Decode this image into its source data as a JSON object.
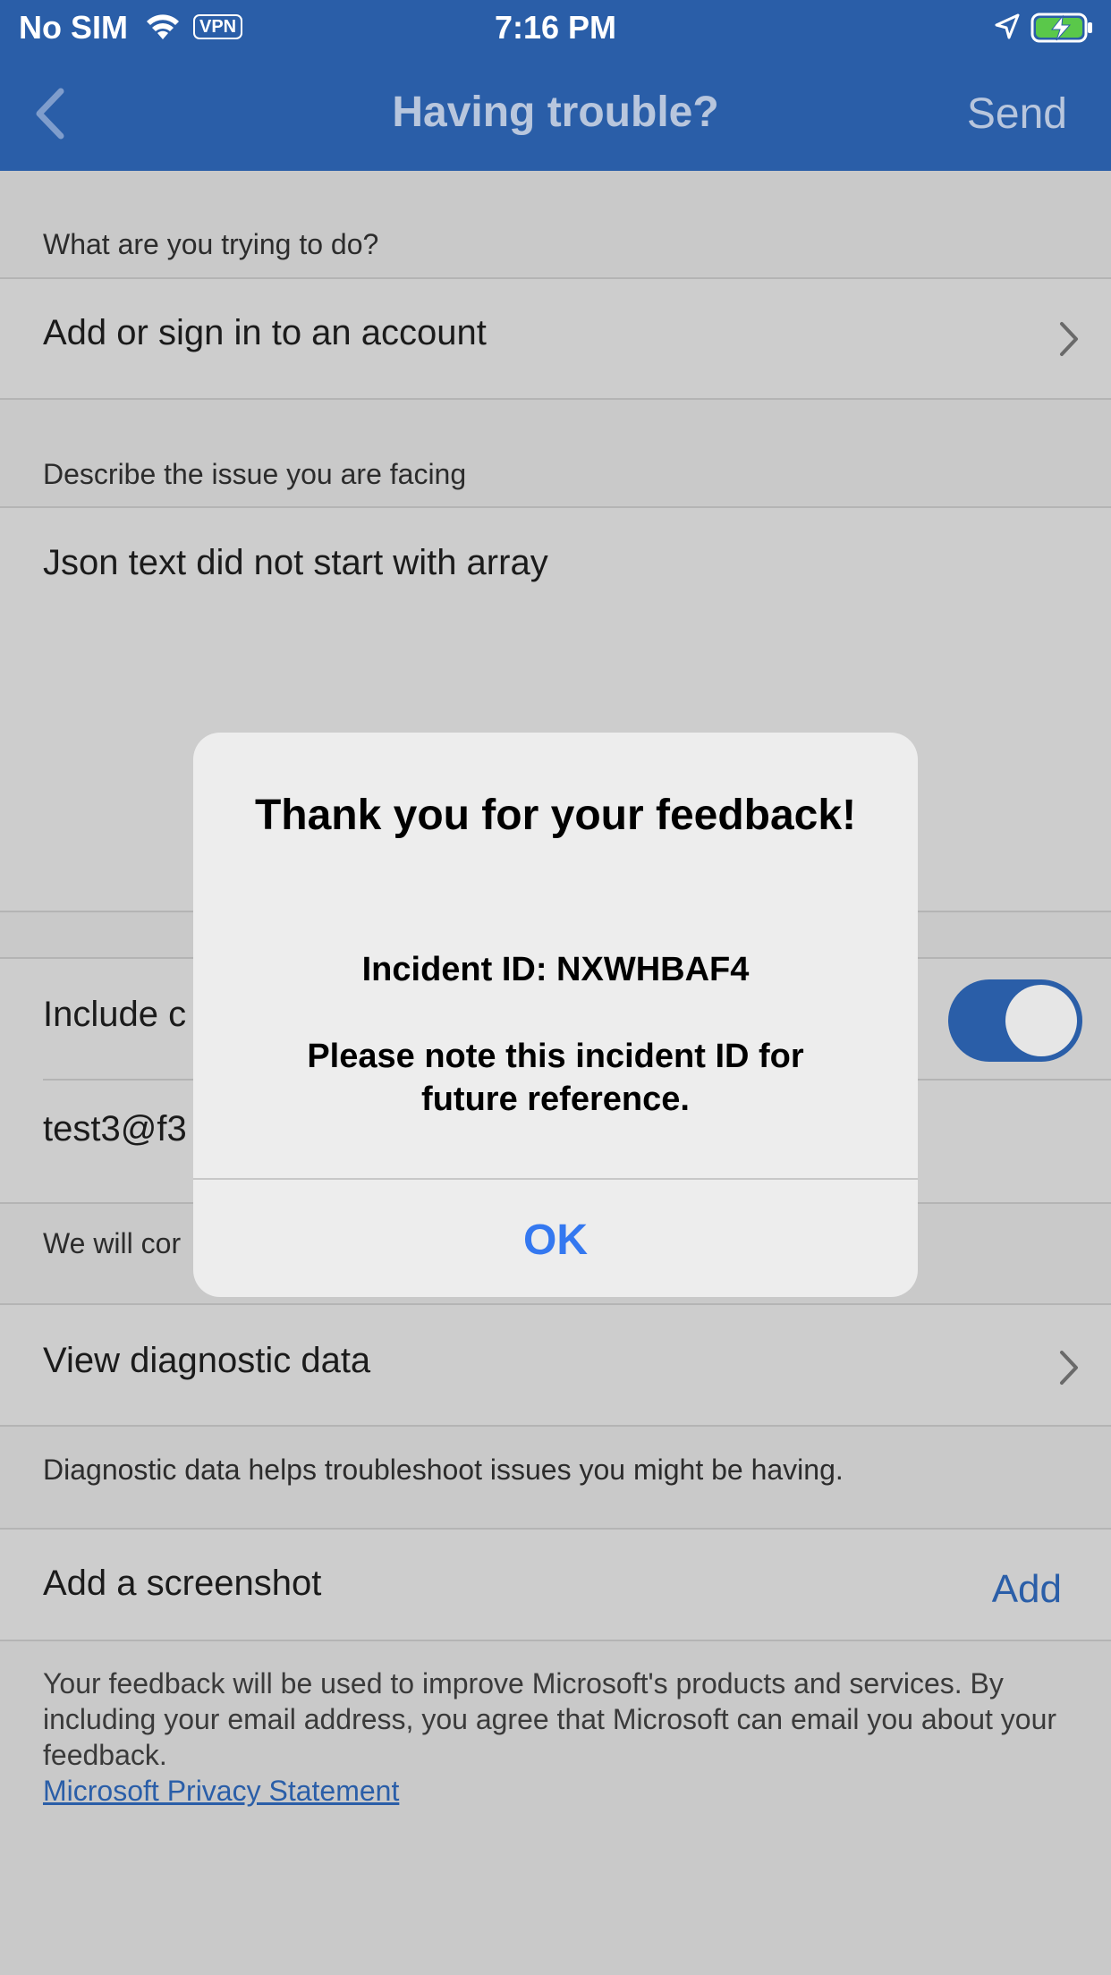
{
  "status_bar": {
    "carrier": "No SIM",
    "vpn": "VPN",
    "time": "7:16 PM"
  },
  "nav": {
    "title": "Having trouble?",
    "send_label": "Send"
  },
  "sections": {
    "trying_to_do_label": "What are you trying to do?",
    "trying_to_do_value": "Add or sign in to an account",
    "describe_label": "Describe the issue you are facing",
    "describe_value": "Json text did not start with array",
    "include_contact_label": "Include c",
    "email_value": "test3@f3",
    "contact_note": "We will cor",
    "view_diagnostic_label": "View diagnostic data",
    "diagnostic_note": "Diagnostic data helps troubleshoot issues you might be having.",
    "screenshot_label": "Add a screenshot",
    "screenshot_add": "Add",
    "footer": "Your feedback will be used to improve Microsoft's products and services. By including your email address, you agree that Microsoft can email you about your feedback.",
    "privacy_link": "Microsoft Privacy Statement"
  },
  "toggle": {
    "on": true
  },
  "dialog": {
    "title": "Thank you for your feedback!",
    "incident": "Incident ID: NXWHBAF4",
    "note": "Please note this incident ID for future reference.",
    "ok_label": "OK"
  },
  "colors": {
    "brand": "#2a5ea8",
    "dialog_button": "#3478f0",
    "background_dimmed": "#c9c9c9"
  },
  "icons": [
    "back-chevron-icon",
    "wifi-icon",
    "location-arrow-icon",
    "battery-charging-icon",
    "chevron-right-icon"
  ]
}
